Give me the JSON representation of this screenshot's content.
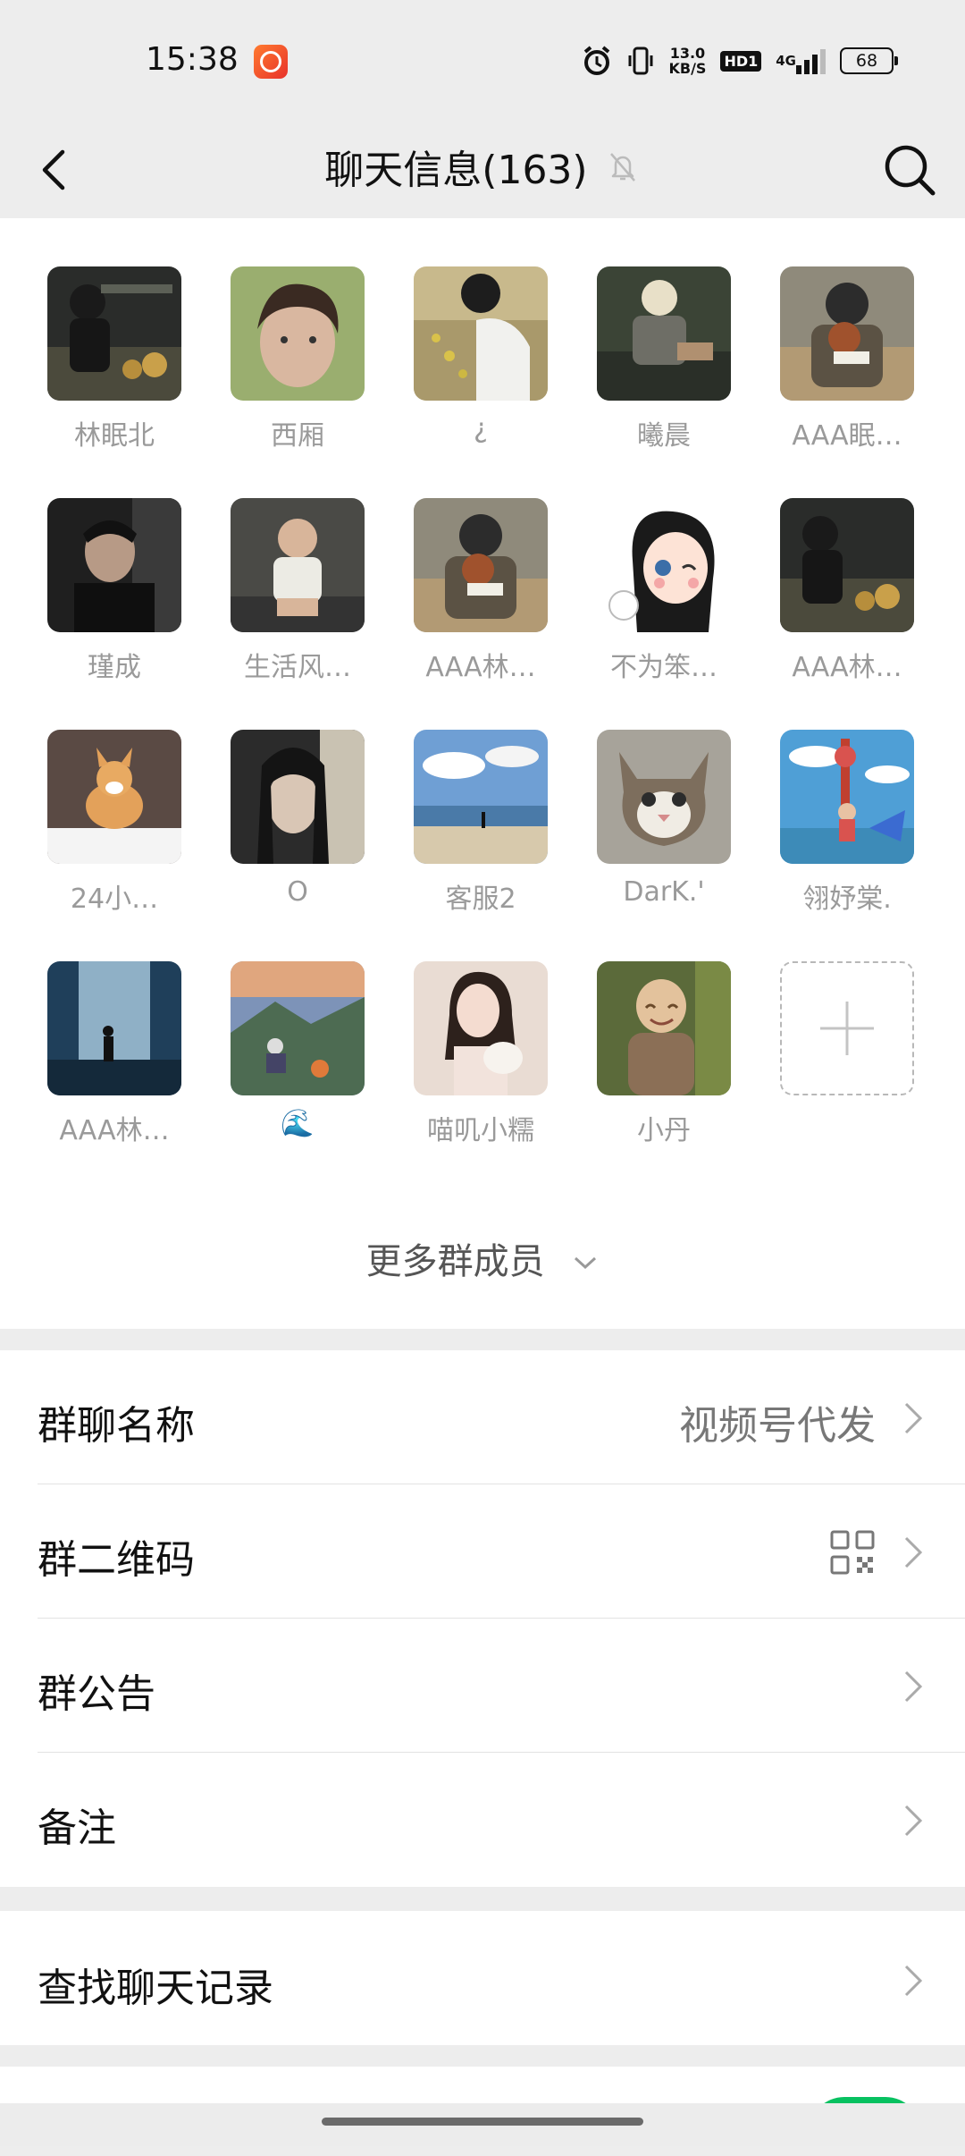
{
  "status_bar": {
    "time": "15:38",
    "net_speed_value": "13.0",
    "net_speed_unit": "KB/S",
    "hd_label": "HD1",
    "network_label": "4G",
    "battery": "68"
  },
  "header": {
    "title": "聊天信息(163)",
    "icons": [
      "back-icon",
      "mute-bell-icon",
      "search-icon"
    ]
  },
  "members": [
    {
      "name": "林眠北",
      "avatar": "avatar-photo-dark-man-table"
    },
    {
      "name": "西厢",
      "avatar": "avatar-photo-boy"
    },
    {
      "name": "¿",
      "avatar": "avatar-photo-child-grass"
    },
    {
      "name": "曦晨",
      "avatar": "avatar-photo-blonde-person"
    },
    {
      "name": "AAA眠…",
      "avatar": "avatar-photo-dog-headphones"
    },
    {
      "name": "瑾成",
      "avatar": "avatar-photo-man-dark"
    },
    {
      "name": "生活风…",
      "avatar": "avatar-photo-toddler"
    },
    {
      "name": "AAA林…",
      "avatar": "avatar-photo-dog-headphones"
    },
    {
      "name": "不为笨…",
      "avatar": "avatar-cartoon-girl"
    },
    {
      "name": "AAA林…",
      "avatar": "avatar-photo-dark-man-table"
    },
    {
      "name": "24小…",
      "avatar": "avatar-photo-corgi"
    },
    {
      "name": "O",
      "avatar": "avatar-photo-long-hair"
    },
    {
      "name": "客服2",
      "avatar": "avatar-photo-beach"
    },
    {
      "name": "DarK.'",
      "avatar": "avatar-photo-cat"
    },
    {
      "name": "翎妤棠.",
      "avatar": "avatar-anime-tower"
    },
    {
      "name": "AAA林…",
      "avatar": "avatar-photo-waterfall"
    },
    {
      "name": "🌊",
      "avatar": "avatar-photo-mountain"
    },
    {
      "name": "喵叽小糯",
      "avatar": "avatar-photo-girl-cat"
    },
    {
      "name": "小丹",
      "avatar": "avatar-photo-little-monk"
    }
  ],
  "more_members_label": "更多群成员",
  "settings": {
    "group_name_label": "群聊名称",
    "group_name_value": "视频号代发",
    "qr_label": "群二维码",
    "announcement_label": "群公告",
    "remark_label": "备注",
    "search_history_label": "查找聊天记录"
  },
  "colors": {
    "accent": "#07c160",
    "background": "#ededed",
    "panel": "#ffffff",
    "secondary_text": "#9a9a9a"
  }
}
